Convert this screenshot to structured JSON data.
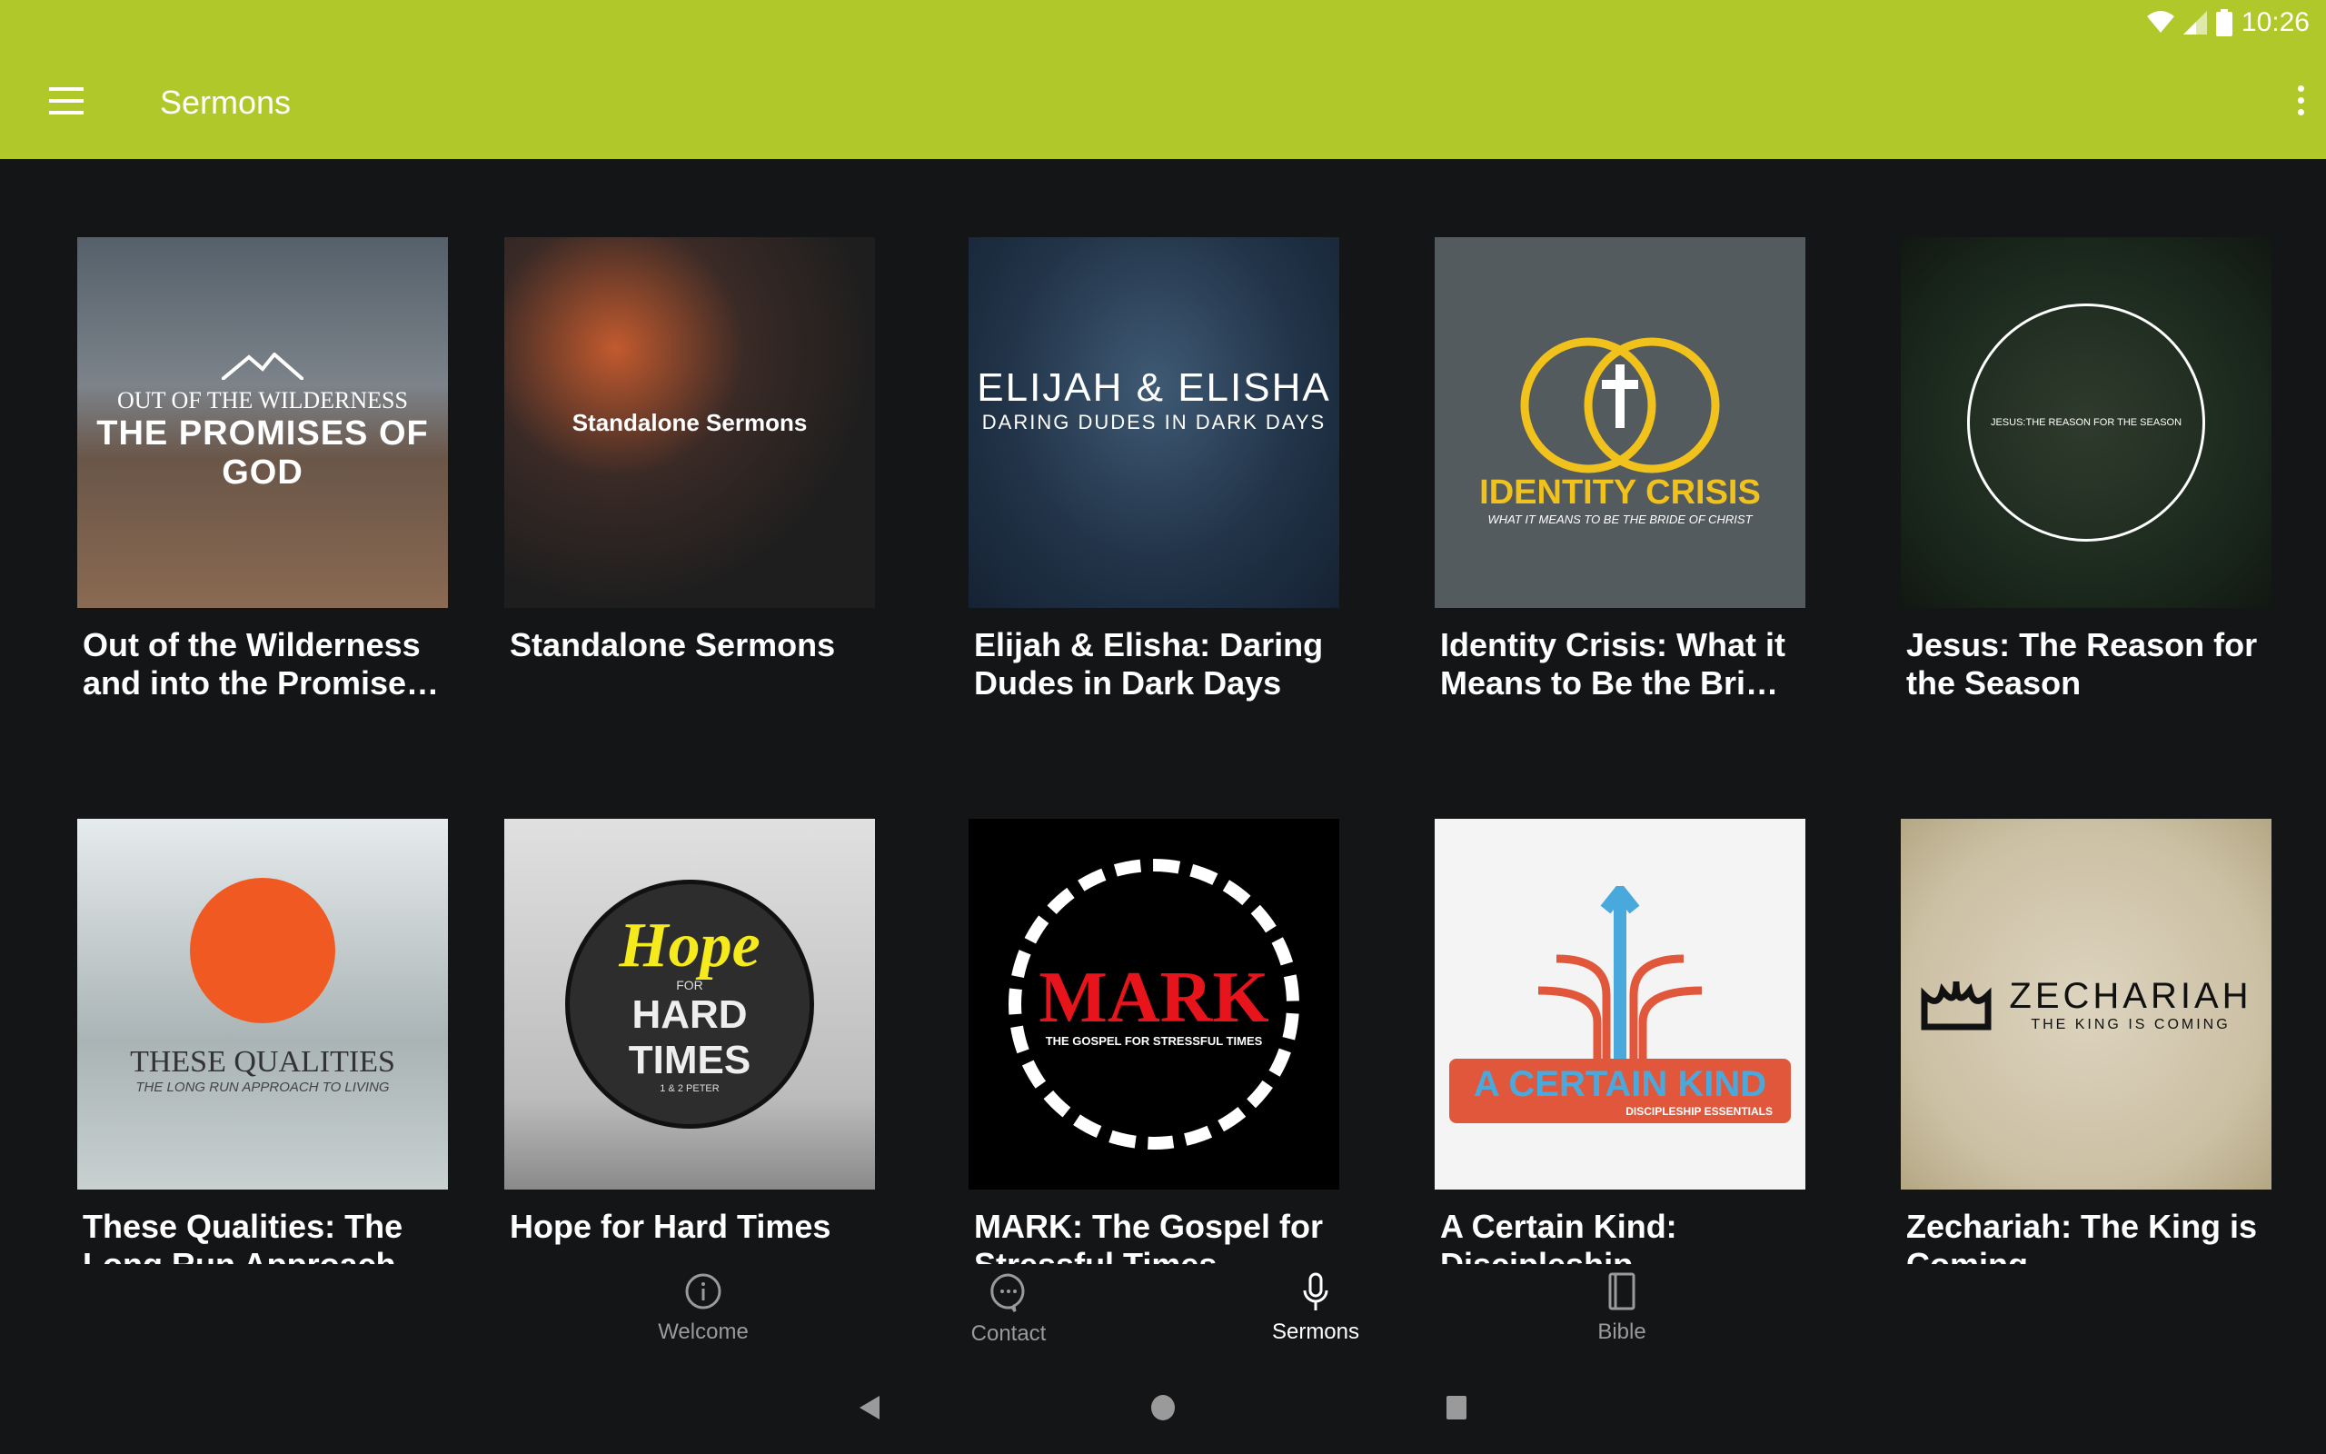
{
  "status_bar": {
    "time": "10:26",
    "icons": [
      "wifi-icon",
      "signal-icon",
      "battery-icon"
    ]
  },
  "app_bar": {
    "title": "Sermons",
    "menu_icon": "hamburger-icon",
    "overflow_icon": "more-vert-icon",
    "color": "#b0c829"
  },
  "series": [
    {
      "title": "Out of the Wilderness and into the Promises of God",
      "art_text": [
        "OUT OF THE WILDERNESS",
        "THE PROMISES OF GOD"
      ]
    },
    {
      "title": "Standalone Sermons",
      "art_text": [
        "Standalone Sermons"
      ]
    },
    {
      "title": "Elijah & Elisha: Daring Dudes in Dark Days",
      "art_text": [
        "ELIJAH & ELISHA",
        "DARING DUDES IN DARK DAYS"
      ]
    },
    {
      "title": "Identity Crisis: What it Means to Be the Bride of Christ",
      "art_text": [
        "IDENTITY CRISIS",
        "WHAT IT MEANS TO BE THE BRIDE OF CHRIST"
      ]
    },
    {
      "title": "Jesus: The Reason for the Season",
      "art_text": [
        "JESUS:THE REASON FOR THE SEASON"
      ]
    },
    {
      "title": "These Qualities: The Long Run Approach to Living",
      "art_text": [
        "THESE QUALITIES",
        "THE LONG RUN APPROACH TO LIVING"
      ]
    },
    {
      "title": "Hope for Hard Times",
      "art_text": [
        "Hope",
        "FOR",
        "HARD TIMES",
        "1 & 2 PETER"
      ]
    },
    {
      "title": "MARK: The Gospel for Stressful Times",
      "art_text": [
        "MARK",
        "THE GOSPEL FOR STRESSFUL TIMES"
      ]
    },
    {
      "title": "A Certain Kind: Discipleship Essentials",
      "art_text": [
        "A CERTAIN KIND",
        "DISCIPLESHIP ESSENTIALS"
      ]
    },
    {
      "title": "Zechariah: The King is Coming",
      "art_text": [
        "ZECHARIAH",
        "THE KING IS COMING"
      ]
    }
  ],
  "bottom_nav": [
    {
      "label": "Welcome",
      "icon": "info-icon",
      "active": false
    },
    {
      "label": "Contact",
      "icon": "chat-bubble-icon",
      "active": false
    },
    {
      "label": "Sermons",
      "icon": "microphone-icon",
      "active": true
    },
    {
      "label": "Bible",
      "icon": "book-icon",
      "active": false
    }
  ],
  "system_nav": [
    "back-icon",
    "home-icon",
    "recents-icon"
  ]
}
